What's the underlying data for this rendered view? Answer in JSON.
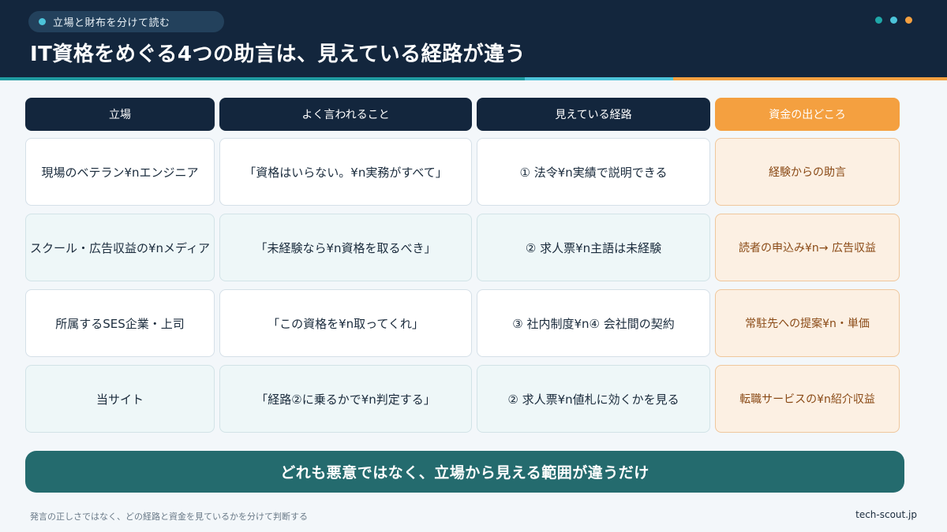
{
  "header": {
    "tag": "立場と財布を分けて読む",
    "title": "IT資格をめぐる4つの助言は、見えている経路が違う",
    "dot_colors": [
      "#1fa7a8",
      "#4cc3d9",
      "#f4a040"
    ],
    "stripe_colors": [
      "#1f9aa0",
      "#4cc3d9",
      "#f4a040"
    ]
  },
  "table": {
    "headers": [
      "立場",
      "よく言われること",
      "見えている経路",
      "資金の出どころ"
    ],
    "rows": [
      [
        "現場のベテラン¥nエンジニア",
        "「資格はいらない。¥n実務がすべて」",
        "① 法令¥n実績で説明できる",
        "経験からの助言"
      ],
      [
        "スクール・広告収益の¥nメディア",
        "「未経験なら¥n資格を取るべき」",
        "② 求人票¥n主語は未経験",
        "読者の申込み¥n→ 広告収益"
      ],
      [
        "所属するSES企業・上司",
        "「この資格を¥n取ってくれ」",
        "③ 社内制度¥n④ 会社間の契約",
        "常駐先への提案¥n・単価"
      ],
      [
        "当サイト",
        "「経路②に乗るかで¥n判定する」",
        "② 求人票¥n値札に効くかを見る",
        "転職サービスの¥n紹介収益"
      ]
    ]
  },
  "banner": "どれも悪意ではなく、立場から見える範囲が違うだけ",
  "footer": {
    "note": "発言の正しさではなく、どの経路と資金を見ているかを分けて判断する",
    "site": "tech-scout.jp"
  }
}
